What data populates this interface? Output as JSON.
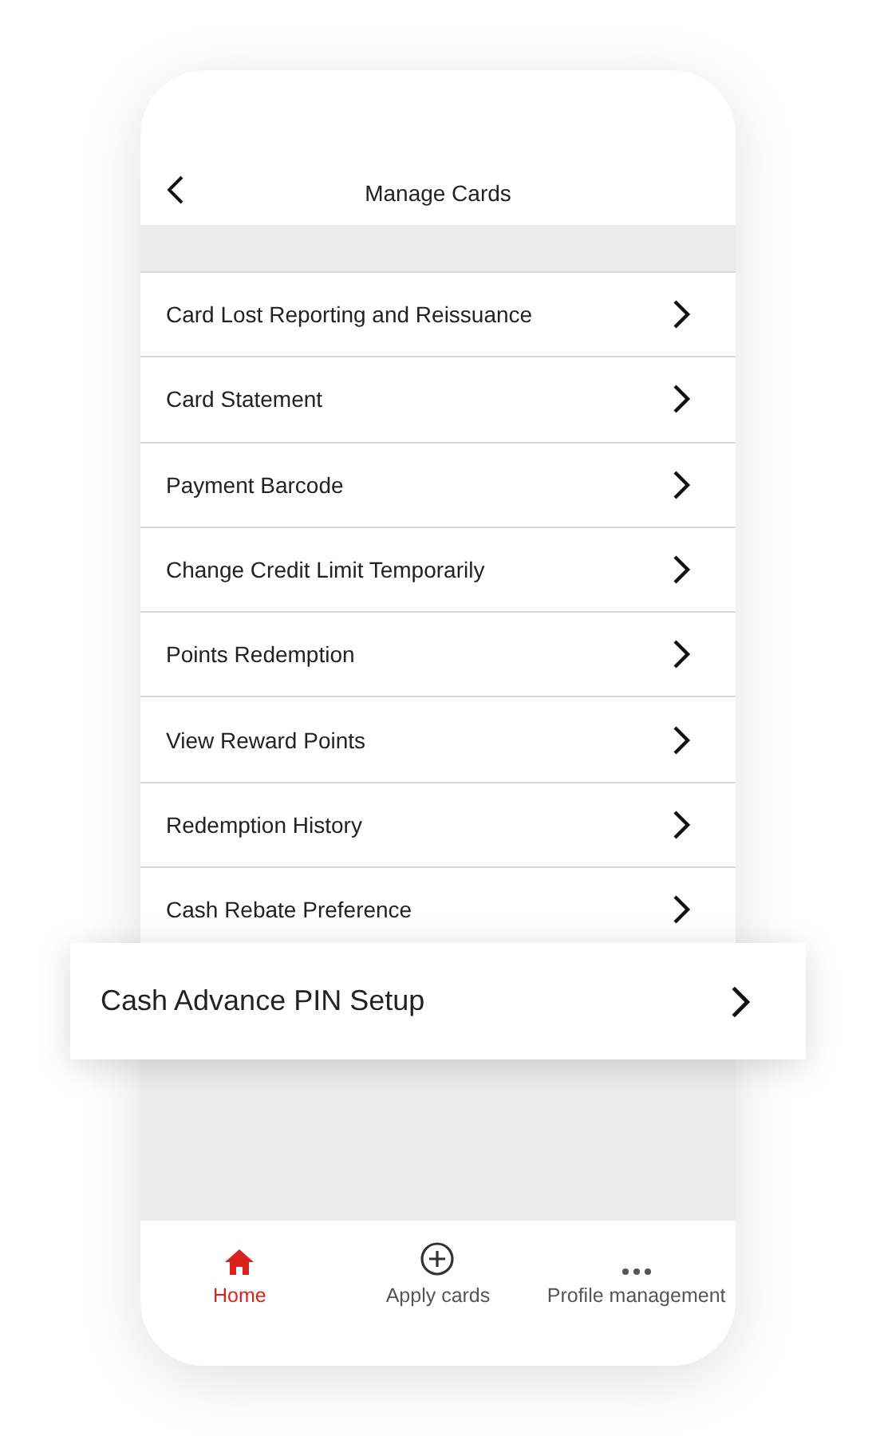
{
  "header": {
    "title": "Manage Cards"
  },
  "menu_items": [
    {
      "label": "Card Lost Reporting and Reissuance"
    },
    {
      "label": "Card Statement"
    },
    {
      "label": "Payment Barcode"
    },
    {
      "label": "Change Credit Limit Temporarily"
    },
    {
      "label": "Points Redemption"
    },
    {
      "label": "View Reward Points"
    },
    {
      "label": "Redemption History"
    },
    {
      "label": "Cash Rebate Preference"
    }
  ],
  "highlighted_item": {
    "label": "Cash Advance PIN Setup"
  },
  "tabs": [
    {
      "kind": "home",
      "label": "Home",
      "selected": true
    },
    {
      "kind": "apply",
      "label": "Apply cards",
      "selected": false
    },
    {
      "kind": "more",
      "label": "Profile management",
      "selected": false
    }
  ]
}
